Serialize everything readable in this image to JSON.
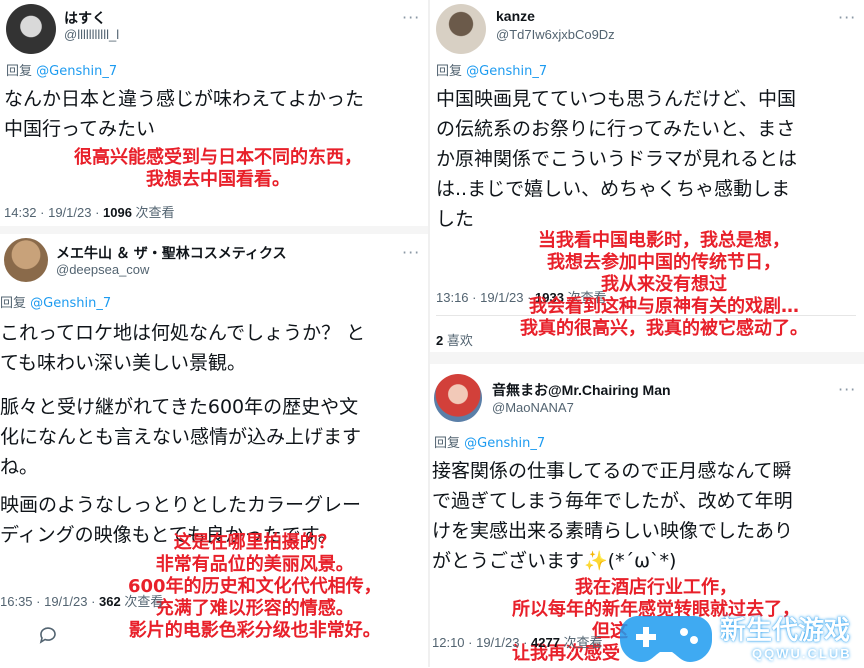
{
  "tweets": [
    {
      "name": "はすく",
      "handle": "@lllllllllll_l",
      "reply_prefix": "回复",
      "reply_to": "@Genshin_7",
      "text": [
        "なんか日本と違う感じが味わえてよかった",
        "中国行ってみたい"
      ],
      "translation": [
        "很高兴能感受到与日本不同的东西，",
        "我想去中国看看。"
      ],
      "time": "14:32 · 19/1/23 · ",
      "views": "1096",
      "views_label": " 次查看"
    },
    {
      "name": "メエ牛山 ＆ ザ・聖林コスメティクス",
      "handle": "@deepsea_cow",
      "reply_prefix": "回复",
      "reply_to": "@Genshin_7",
      "text": [
        "これってロケ地は何処なんでしょうか？ と",
        "ても味わい深い美しい景観。",
        "脈々と受け継がれてきた600年の歴史や文",
        "化になんとも言えない感情が込み上げます",
        "ね。",
        "映画のようなしっとりとしたカラーグレー",
        "ディングの映像もとても良かったです。"
      ],
      "translation": [
        "这是在哪里拍摄的？",
        "非常有品位的美丽风景。",
        "600年的历史和文化代代相传，",
        "充满了难以形容的情感。",
        "影片的电影色彩分级也非常好。"
      ],
      "time": "16:35 · 19/1/23 · ",
      "views": "362",
      "views_label": " 次查看"
    },
    {
      "name": "kanze",
      "handle": "@Td7Iw6xjxbCo9Dz",
      "reply_prefix": "回复",
      "reply_to": "@Genshin_7",
      "text": [
        "中国映画見てていつも思うんだけど、中国",
        "の伝統系のお祭りに行ってみたいと、まさ",
        "か原神関係でこういうドラマが見れるとは",
        "は..まじで嬉しい、めちゃくちゃ感動しま",
        "した"
      ],
      "translation": [
        "当我看中国电影时，我总是想，",
        "我想去参加中国的传统节日，",
        "我从来没有想过",
        "我会看到这种与原神有关的戏剧…",
        "我真的很高兴，我真的被它感动了。"
      ],
      "time": "13:16 · 19/1/23 · ",
      "views": "1933",
      "views_label": " 次查看",
      "likes": "2",
      "likes_label": " 喜欢"
    },
    {
      "name": "音無まお@Mr.Chairing Man",
      "handle": "@MaoNANA7",
      "reply_prefix": "回复",
      "reply_to": "@Genshin_7",
      "text": [
        "接客関係の仕事してるので正月感なんて瞬",
        "で過ぎてしまう毎年でしたが、改めて年明",
        "けを実感出来る素晴らしい映像でしたあり",
        "がとうございます✨(*´ω`*)"
      ],
      "translation": [
        "我在酒店行业工作，",
        "所以每年的新年感觉转眼就过去了，",
        "但这",
        "让我再次感受"
      ],
      "time": "12:10 · 19/1/23 · ",
      "views": "4277",
      "views_label": " 次查看"
    }
  ],
  "more_icon": "···",
  "reply_icon": "reply-icon",
  "watermark": {
    "title": "新生代游戏",
    "url": "QQWU.CLUB"
  },
  "colors": {
    "translation": "#e8202a",
    "link": "#1d9bf0",
    "muted": "#536471"
  }
}
